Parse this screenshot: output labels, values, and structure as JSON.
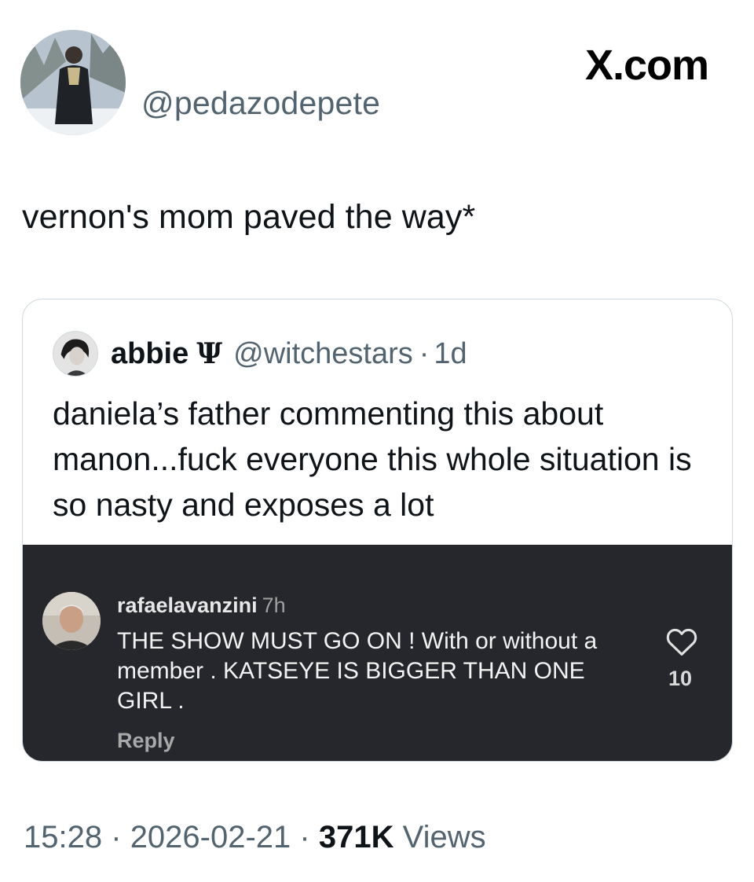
{
  "author": {
    "handle": "@pedazodepete",
    "avatar": "profile-photo"
  },
  "brand": "X.com",
  "tweet": {
    "text": "vernon's mom paved the way*"
  },
  "quote": {
    "name": "abbie",
    "emoji": "Ψ",
    "handle": "@witchestars",
    "separator": "·",
    "time": "1d",
    "text": "daniela’s father commenting this about manon...fuck everyone this whole situation is so nasty and exposes a lot"
  },
  "comment": {
    "username": "rafaelavanzini",
    "time": "7h",
    "text": "THE SHOW MUST GO ON ! With or without a member . KATSEYE IS BIGGER THAN ONE GIRL .",
    "reply_label": "Reply",
    "likes": "10",
    "like_icon": "heart-icon"
  },
  "meta": {
    "time": "15:28",
    "sep1": "·",
    "date": "2026-02-21",
    "sep2": "·",
    "views_count": "371K",
    "views_label": "Views"
  },
  "colors": {
    "muted": "#536471",
    "text": "#0f1419",
    "embed_bg": "#26272c",
    "border": "#cfd9de"
  }
}
